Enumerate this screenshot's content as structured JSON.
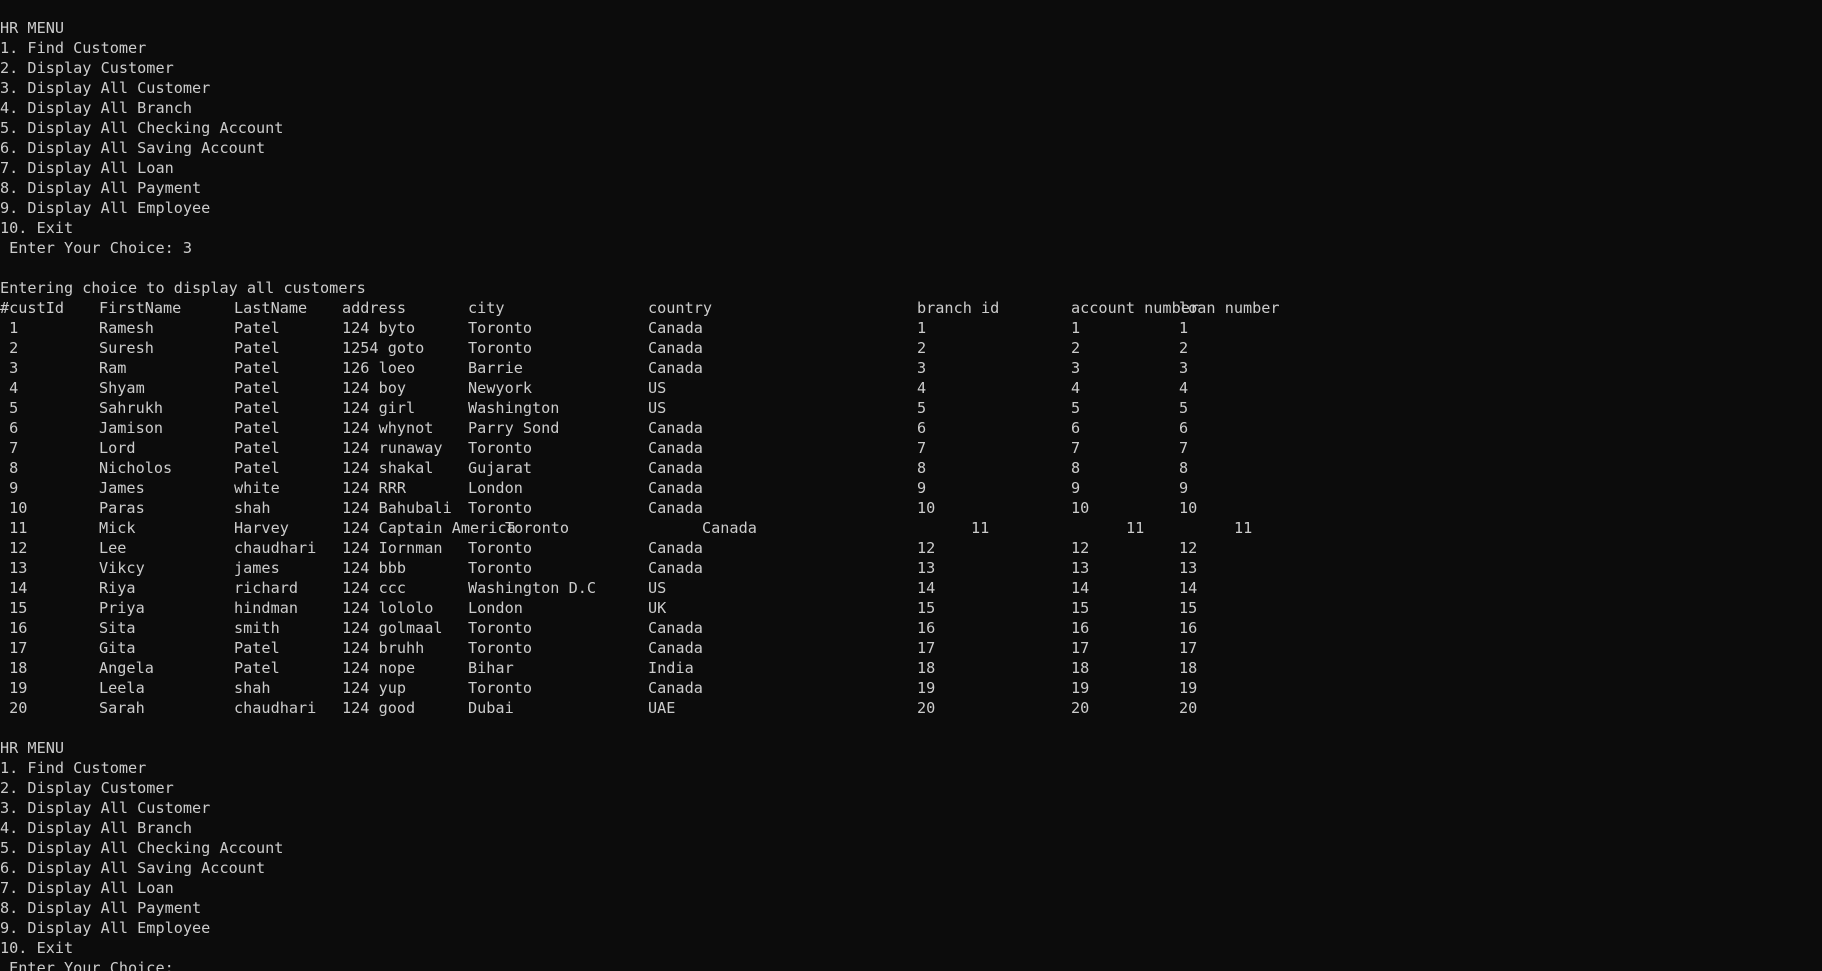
{
  "menu": {
    "title": "HR MENU",
    "items": [
      "1. Find Customer",
      "2. Display Customer",
      "3. Display All Customer",
      "4. Display All Branch",
      "5. Display All Checking Account",
      "6. Display All Saving Account",
      "7. Display All Loan",
      "8. Display All Payment",
      "9. Display All Employee",
      "10. Exit"
    ],
    "prompt_first": " Enter Your Choice: 3",
    "prompt_second": " Enter Your Choice: "
  },
  "status_message": "Entering choice to display all customers",
  "table": {
    "headers": [
      "#custId",
      "FirstName",
      "LastName",
      "address",
      "city",
      "country",
      "branch id",
      "account number",
      "loan number"
    ],
    "rows": [
      [
        " 1",
        "Ramesh",
        "Patel",
        "124 byto",
        "Toronto",
        "Canada",
        "1",
        "1",
        "1"
      ],
      [
        " 2",
        "Suresh",
        "Patel",
        "1254 goto",
        "Toronto",
        "Canada",
        "2",
        "2",
        "2"
      ],
      [
        " 3",
        "Ram",
        "Patel",
        "126 loeo",
        "Barrie",
        "Canada",
        "3",
        "3",
        "3"
      ],
      [
        " 4",
        "Shyam",
        "Patel",
        "124 boy",
        "Newyork",
        "US",
        "4",
        "4",
        "4"
      ],
      [
        " 5",
        "Sahrukh",
        "Patel",
        "124 girl",
        "Washington",
        "US",
        "5",
        "5",
        "5"
      ],
      [
        " 6",
        "Jamison",
        "Patel",
        "124 whynot",
        "Parry Sond",
        "Canada",
        "6",
        "6",
        "6"
      ],
      [
        " 7",
        "Lord",
        "Patel",
        "124 runaway",
        "Toronto",
        "Canada",
        "7",
        "7",
        "7"
      ],
      [
        " 8",
        "Nicholos",
        "Patel",
        "124 shakal",
        "Gujarat",
        "Canada",
        "8",
        "8",
        "8"
      ],
      [
        " 9",
        "James",
        "white",
        "124 RRR",
        "London",
        "Canada",
        "9",
        "9",
        "9"
      ],
      [
        " 10",
        "Paras",
        "shah",
        "124 Bahubali",
        "Toronto",
        "Canada",
        "10",
        "10",
        "10"
      ],
      [
        " 11",
        "Mick",
        "Harvey",
        "124 Captain America",
        "Toronto",
        "Canada",
        "11",
        "11",
        "11"
      ],
      [
        " 12",
        "Lee",
        "chaudhari",
        "124 Iornman",
        "Toronto",
        "Canada",
        "12",
        "12",
        "12"
      ],
      [
        " 13",
        "Vikcy",
        "james",
        "124 bbb",
        "Toronto",
        "Canada",
        "13",
        "13",
        "13"
      ],
      [
        " 14",
        "Riya",
        "richard",
        "124 ccc",
        "Washington D.C",
        "US",
        "14",
        "14",
        "14"
      ],
      [
        " 15",
        "Priya",
        "hindman",
        "124 lololo",
        "London",
        "UK",
        "15",
        "15",
        "15"
      ],
      [
        " 16",
        "Sita",
        "smith",
        "124 golmaal",
        "Toronto",
        "Canada",
        "16",
        "16",
        "16"
      ],
      [
        " 17",
        "Gita",
        "Patel",
        "124 bruhh",
        "Toronto",
        "Canada",
        "17",
        "17",
        "17"
      ],
      [
        " 18",
        "Angela",
        "Patel",
        "124 nope",
        "Bihar",
        "India",
        "18",
        "18",
        "18"
      ],
      [
        " 19",
        "Leela",
        "shah",
        "124 yup",
        "Toronto",
        "Canada",
        "19",
        "19",
        "19"
      ],
      [
        " 20",
        "Sarah",
        "chaudhari",
        "124 good",
        "Dubai",
        "UAE",
        "20",
        "20",
        "20"
      ]
    ]
  },
  "colors": {
    "background": "#0c0c0c",
    "text": "#cccccc"
  }
}
